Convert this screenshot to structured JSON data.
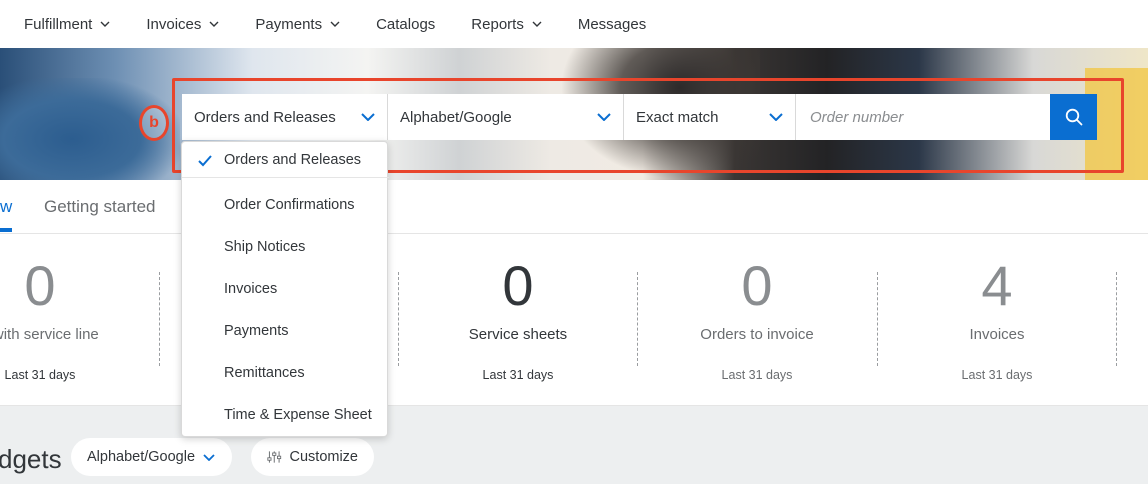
{
  "nav": {
    "items": [
      {
        "label": "Fulfillment",
        "has_dropdown": true
      },
      {
        "label": "Invoices",
        "has_dropdown": true
      },
      {
        "label": "Payments",
        "has_dropdown": true
      },
      {
        "label": "Catalogs",
        "has_dropdown": false
      },
      {
        "label": "Reports",
        "has_dropdown": true
      },
      {
        "label": "Messages",
        "has_dropdown": false
      }
    ]
  },
  "annotation": {
    "badge": "b",
    "color": "#e8452c"
  },
  "search": {
    "document_type": "Orders and Releases",
    "customer": "Alphabet/Google",
    "match_type": "Exact match",
    "placeholder": "Order number",
    "button_icon": "search-icon",
    "accent": "#0a6ed1"
  },
  "dropdown": {
    "items": [
      {
        "label": "Orders and Releases",
        "selected": true
      },
      {
        "label": "Order Confirmations",
        "selected": false
      },
      {
        "label": "Ship Notices",
        "selected": false
      },
      {
        "label": "Invoices",
        "selected": false
      },
      {
        "label": "Payments",
        "selected": false
      },
      {
        "label": "Remittances",
        "selected": false
      },
      {
        "label": "Time & Expense Sheet",
        "selected": false
      }
    ]
  },
  "tabs": {
    "overview": "w",
    "getting_started": "Getting started"
  },
  "tiles": [
    {
      "value": "0",
      "label": "s with service line",
      "period": "Last 31 days"
    },
    {
      "value": "0",
      "label": "Service sheets",
      "period": "Last 31 days"
    },
    {
      "value": "0",
      "label": "Orders to invoice",
      "period": "Last 31 days"
    },
    {
      "value": "4",
      "label": "Invoices",
      "period": "Last 31 days"
    }
  ],
  "widgets": {
    "title": "dgets",
    "customer_filter": "Alphabet/Google",
    "customize_label": "Customize"
  }
}
